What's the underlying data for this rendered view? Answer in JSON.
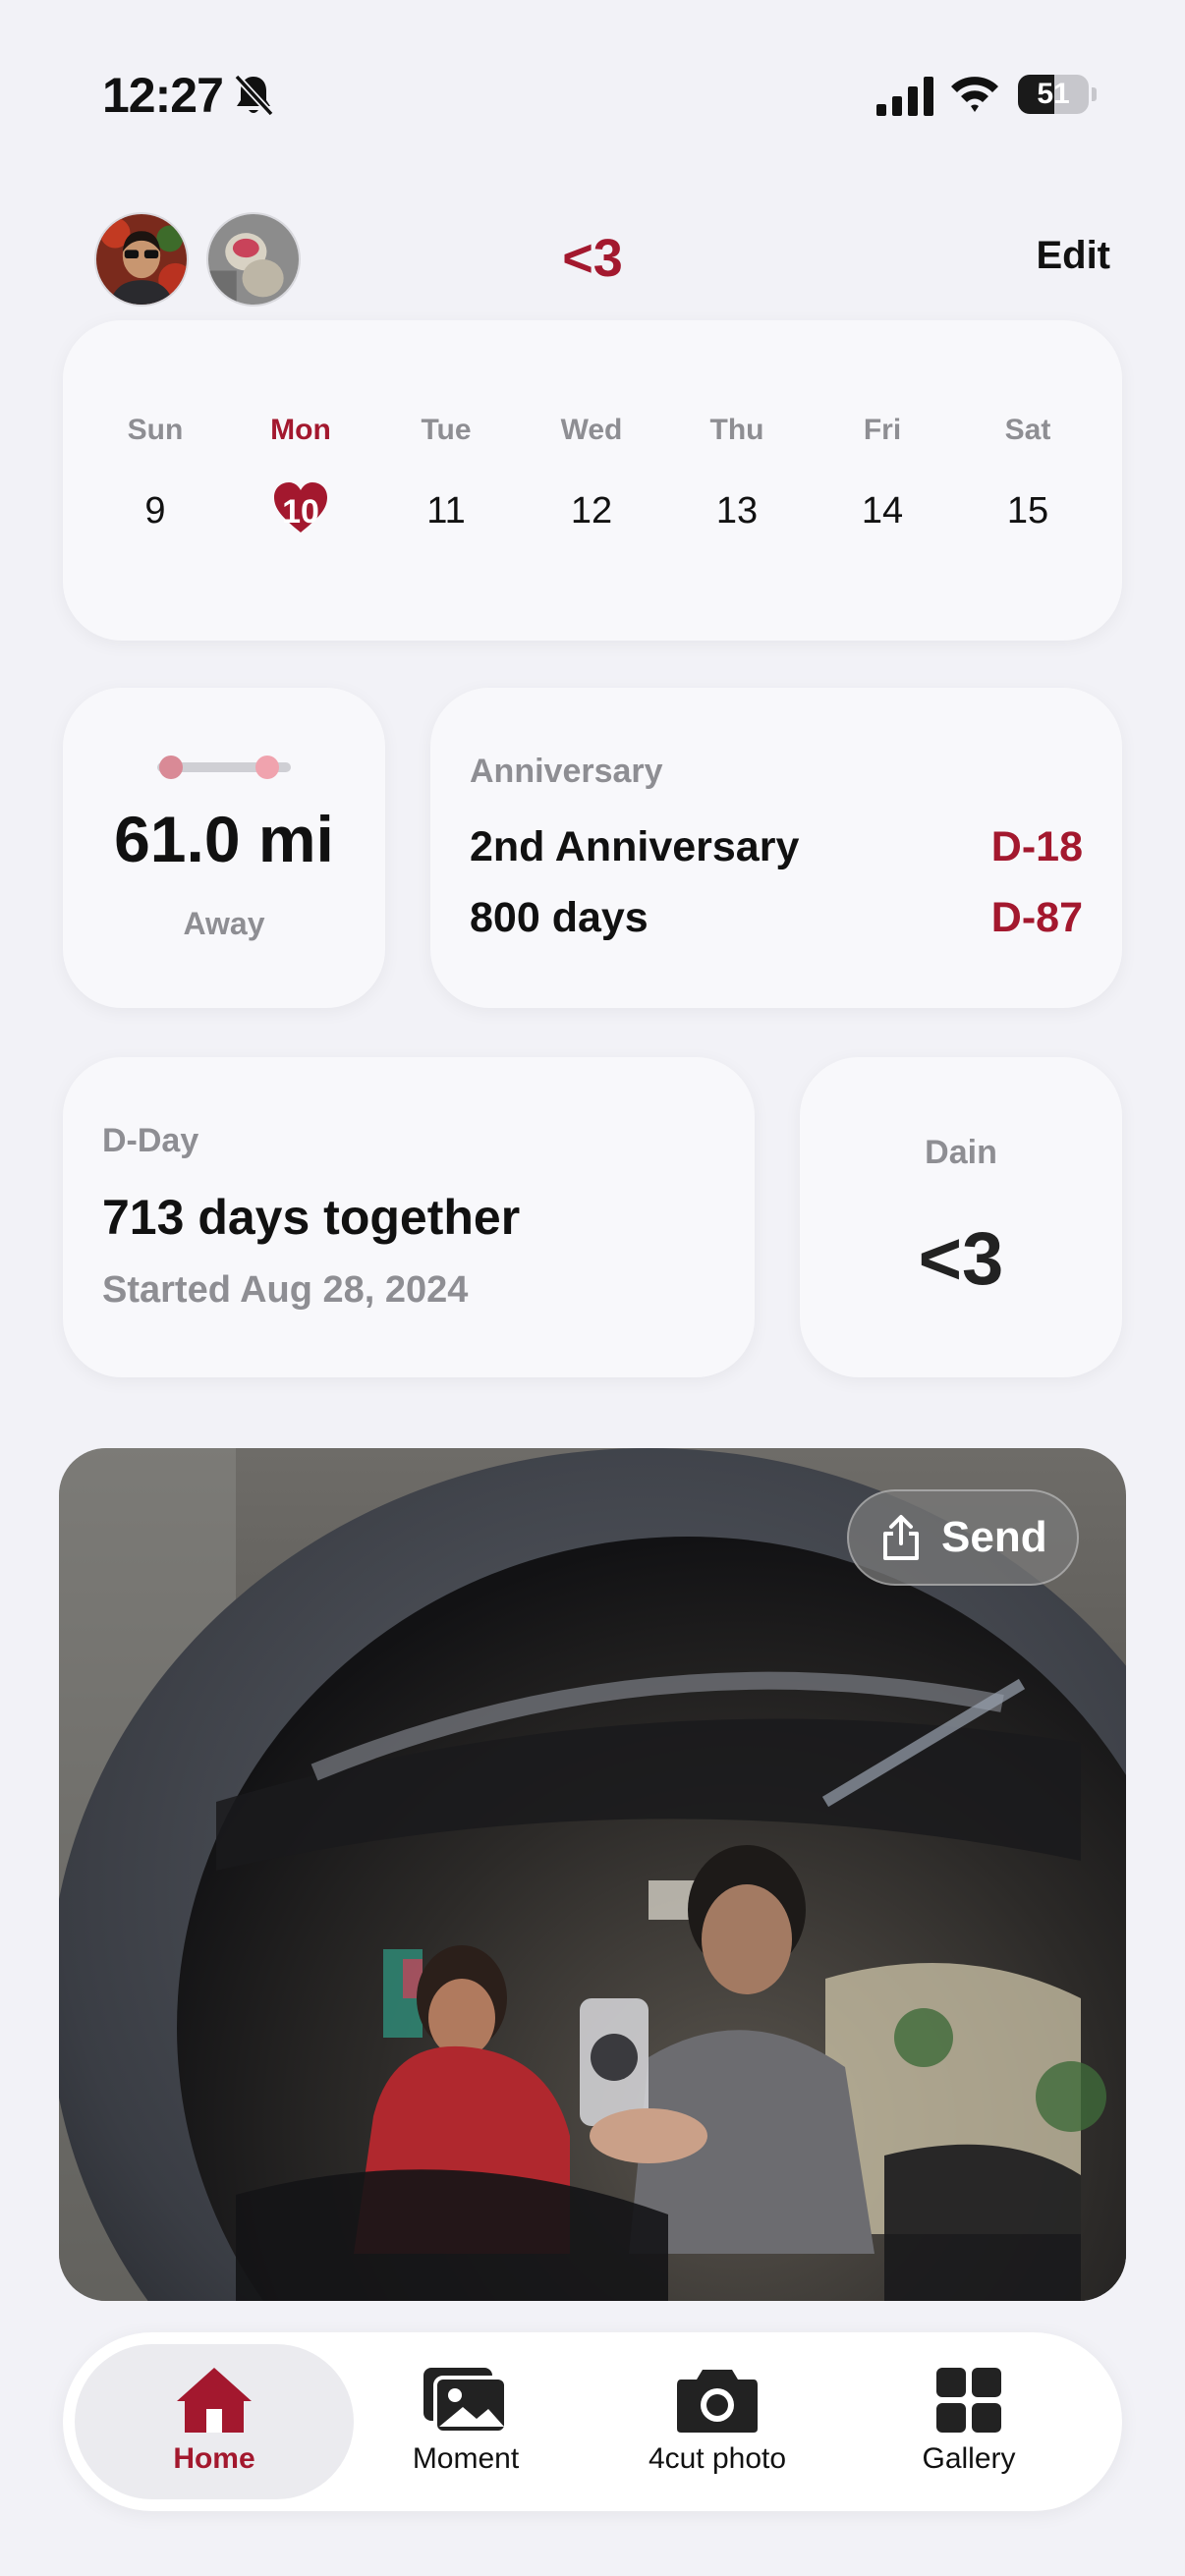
{
  "status_bar": {
    "time": "12:27",
    "battery_percent": "51",
    "battery_level": 0.51
  },
  "header": {
    "title": "<3",
    "edit_label": "Edit"
  },
  "calendar": {
    "days": [
      {
        "name": "Sun",
        "number": "9"
      },
      {
        "name": "Mon",
        "number": "10",
        "selected": true
      },
      {
        "name": "Tue",
        "number": "11"
      },
      {
        "name": "Wed",
        "number": "12"
      },
      {
        "name": "Thu",
        "number": "13"
      },
      {
        "name": "Fri",
        "number": "14"
      },
      {
        "name": "Sat",
        "number": "15"
      }
    ]
  },
  "distance": {
    "value": "61.0 mi",
    "label": "Away"
  },
  "anniversary": {
    "heading": "Anniversary",
    "items": [
      {
        "name": "2nd Anniversary",
        "countdown": "D-18"
      },
      {
        "name": "800 days",
        "countdown": "D-87"
      }
    ]
  },
  "dday": {
    "heading": "D-Day",
    "main": "713 days together",
    "sub": "Started Aug 28, 2024"
  },
  "partner": {
    "name": "Dain",
    "value": "<3"
  },
  "photo": {
    "send_label": "Send"
  },
  "tabbar": {
    "tabs": [
      {
        "label": "Home",
        "icon": "home-icon",
        "active": true
      },
      {
        "label": "Moment",
        "icon": "photos-icon"
      },
      {
        "label": "4cut photo",
        "icon": "camera-icon"
      },
      {
        "label": "Gallery",
        "icon": "grid-icon"
      }
    ]
  },
  "colors": {
    "accent": "#a3182e",
    "background": "#f2f2f7",
    "card": "#f8f8fb",
    "muted": "#8e8e93"
  }
}
